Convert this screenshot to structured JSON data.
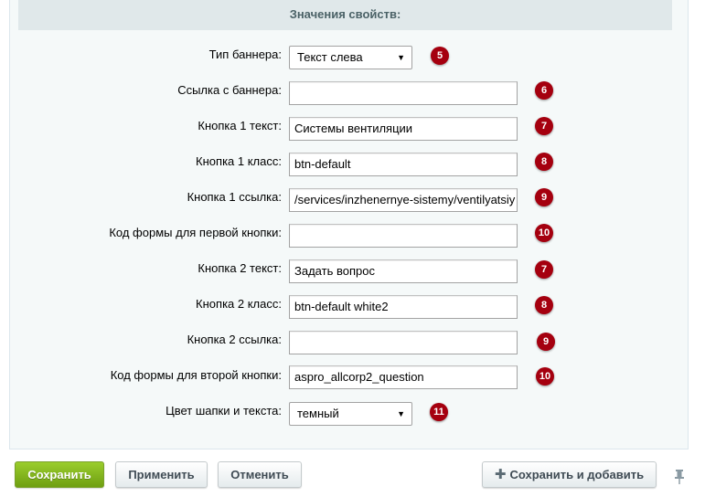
{
  "section_title": "Значения свойств:",
  "rows": [
    {
      "label": "Тип баннера:",
      "value": "Текст слева",
      "badge": "5",
      "kind": "select"
    },
    {
      "label": "Ссылка с баннера:",
      "value": "",
      "badge": "6",
      "kind": "text"
    },
    {
      "label": "Кнопка 1 текст:",
      "value": "Системы вентиляции",
      "badge": "7",
      "kind": "text"
    },
    {
      "label": "Кнопка 1 класс:",
      "value": "btn-default",
      "badge": "8",
      "kind": "text"
    },
    {
      "label": "Кнопка 1 ссылка:",
      "value": "/services/inzhenernye-sistemy/ventilyatsiy",
      "badge": "9",
      "kind": "text"
    },
    {
      "label": "Код формы для первой кнопки:",
      "value": "",
      "badge": "10",
      "kind": "text"
    },
    {
      "label": "Кнопка 2 текст:",
      "value": "Задать вопрос",
      "badge": "7",
      "kind": "text"
    },
    {
      "label": "Кнопка 2 класс:",
      "value": "btn-default white2",
      "badge": "8",
      "kind": "text"
    },
    {
      "label": "Кнопка 2 ссылка:",
      "value": "",
      "badge": "9",
      "kind": "text"
    },
    {
      "label": "Код формы для второй кнопки:",
      "value": "aspro_allcorp2_question",
      "badge": "10",
      "kind": "text"
    },
    {
      "label": "Цвет шапки и текста:",
      "value": "темный",
      "badge": "11",
      "kind": "select"
    }
  ],
  "buttons": {
    "save": "Сохранить",
    "apply": "Применить",
    "cancel": "Отменить",
    "save_add": "Сохранить и добавить"
  },
  "colors": {
    "badge": "#a5000f",
    "save_button": "#86b61f",
    "header_bg": "#e0e8ea"
  },
  "icons": {
    "select_arrow": "triangle-down",
    "add": "plus-icon",
    "pin": "pin-icon"
  }
}
